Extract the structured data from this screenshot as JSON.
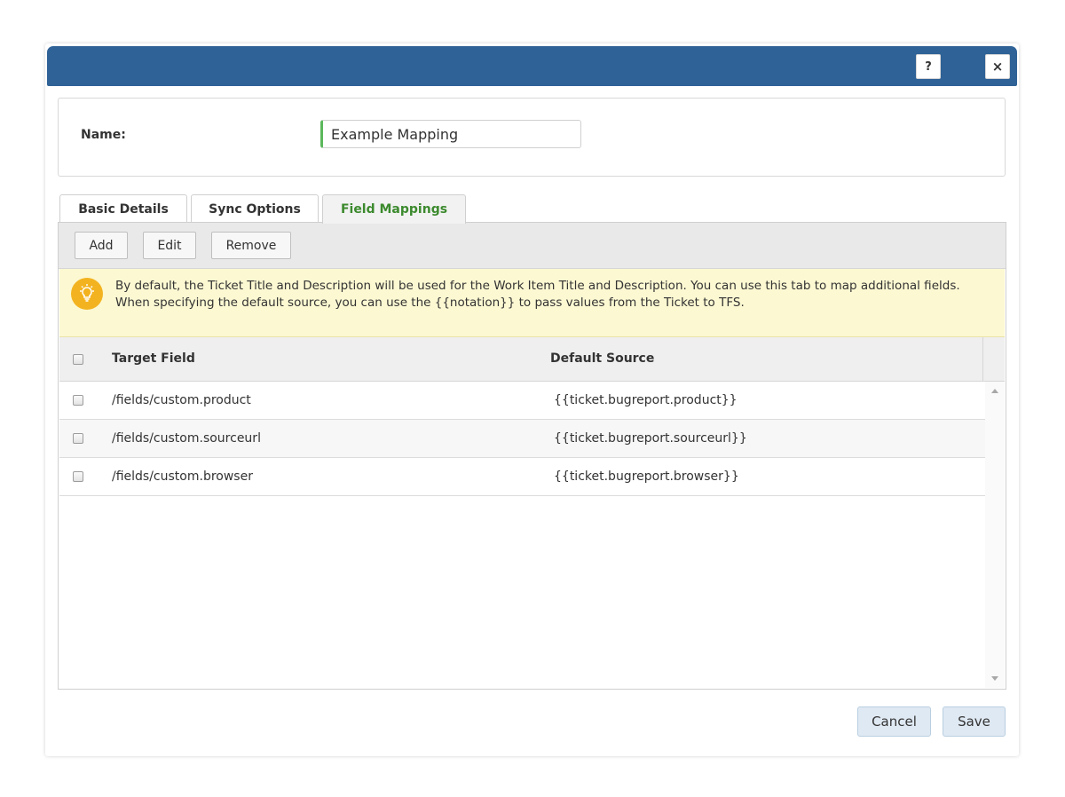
{
  "header": {
    "help_label": "?",
    "close_label": "×"
  },
  "name_field": {
    "label": "Name:",
    "value": "Example Mapping"
  },
  "tabs": [
    {
      "label": "Basic Details",
      "active": false
    },
    {
      "label": "Sync Options",
      "active": false
    },
    {
      "label": "Field Mappings",
      "active": true
    }
  ],
  "toolbar": {
    "add_label": "Add",
    "edit_label": "Edit",
    "remove_label": "Remove"
  },
  "info": {
    "icon": "lightbulb-icon",
    "text": "By default, the Ticket Title and Description will be used for the Work Item Title and Description. You can use this tab to map additional fields. When specifying the default source, you can use the {{notation}} to pass values from the Ticket to TFS."
  },
  "table": {
    "columns": [
      "Target Field",
      "Default Source"
    ],
    "rows": [
      {
        "target": "/fields/custom.product",
        "source": "{{ticket.bugreport.product}}"
      },
      {
        "target": "/fields/custom.sourceurl",
        "source": "{{ticket.bugreport.sourceurl}}"
      },
      {
        "target": "/fields/custom.browser",
        "source": "{{ticket.bugreport.browser}}"
      }
    ]
  },
  "footer": {
    "cancel_label": "Cancel",
    "save_label": "Save"
  },
  "colors": {
    "titlebar": "#2f6296",
    "active_tab_text": "#3c8a2e",
    "info_background": "#fcf8d2",
    "bulb": "#f3b320",
    "footer_button": "#dfe9f3"
  }
}
